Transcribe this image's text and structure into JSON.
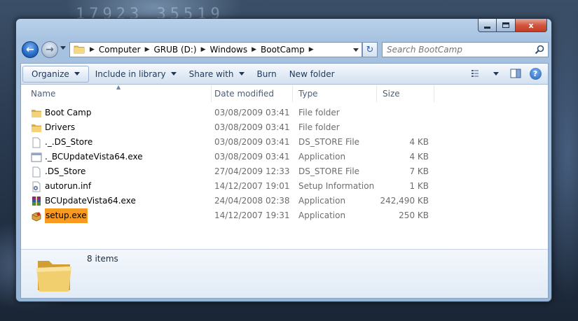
{
  "window": {
    "controls": {
      "minimize": "minimize",
      "maximize": "maximize",
      "close": "x"
    }
  },
  "background": {
    "digits": "17923  35519"
  },
  "address_bar": {
    "crumbs": [
      "Computer",
      "GRUB (D:)",
      "Windows",
      "BootCamp"
    ]
  },
  "search": {
    "placeholder": "Search BootCamp"
  },
  "toolbar": {
    "organize": "Organize",
    "include_in_library": "Include in library",
    "share_with": "Share with",
    "burn": "Burn",
    "new_folder": "New folder"
  },
  "columns": {
    "name": "Name",
    "date": "Date modified",
    "type": "Type",
    "size": "Size"
  },
  "files": [
    {
      "name": "Boot Camp",
      "date": "03/08/2009 03:41",
      "type": "File folder",
      "size": "",
      "icon": "folder-icon"
    },
    {
      "name": "Drivers",
      "date": "03/08/2009 03:41",
      "type": "File folder",
      "size": "",
      "icon": "folder-icon"
    },
    {
      "name": "._.DS_Store",
      "date": "03/08/2009 03:41",
      "type": "DS_STORE File",
      "size": "4 KB",
      "icon": "blank-file-icon"
    },
    {
      "name": "._BCUpdateVista64.exe",
      "date": "03/08/2009 03:41",
      "type": "Application",
      "size": "4 KB",
      "icon": "application-icon"
    },
    {
      "name": ".DS_Store",
      "date": "27/04/2009 12:33",
      "type": "DS_STORE File",
      "size": "7 KB",
      "icon": "blank-file-icon"
    },
    {
      "name": "autorun.inf",
      "date": "14/12/2007 19:01",
      "type": "Setup Information",
      "size": "1 KB",
      "icon": "settings-file-icon"
    },
    {
      "name": "BCUpdateVista64.exe",
      "date": "24/04/2008 02:38",
      "type": "Application",
      "size": "242,490 KB",
      "icon": "installer-archive-icon"
    },
    {
      "name": "setup.exe",
      "date": "14/12/2007 19:31",
      "type": "Application",
      "size": "250 KB",
      "icon": "setup-box-icon"
    }
  ],
  "details": {
    "item_count": "8 items"
  },
  "colors": {
    "selection": "#f79a1f",
    "toolbar_text": "#1e395b",
    "meta_text": "#6d6d6d"
  }
}
